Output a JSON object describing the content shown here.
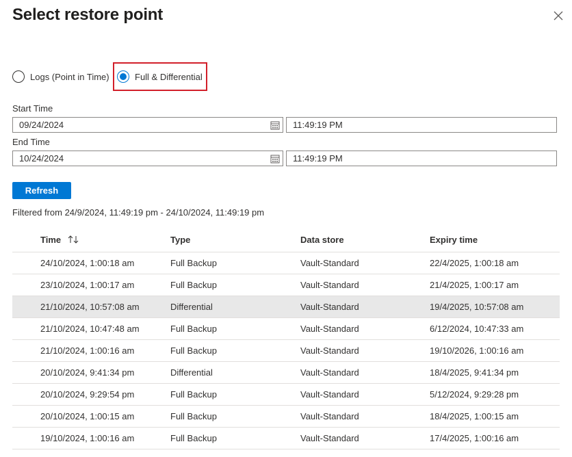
{
  "dialog": {
    "title": "Select restore point"
  },
  "restore_type": {
    "options": [
      {
        "label": "Logs (Point in Time)",
        "selected": false
      },
      {
        "label": "Full & Differential",
        "selected": true
      }
    ]
  },
  "filters": {
    "start_label": "Start Time",
    "start_date": "09/24/2024",
    "start_time": "11:49:19 PM",
    "end_label": "End Time",
    "end_date": "10/24/2024",
    "end_time": "11:49:19 PM"
  },
  "refresh_label": "Refresh",
  "filtered_text": "Filtered from 24/9/2024, 11:49:19 pm - 24/10/2024, 11:49:19 pm",
  "table": {
    "headers": [
      "Time",
      "Type",
      "Data store",
      "Expiry time"
    ],
    "sort_icon": "sort-icon",
    "rows": [
      [
        "24/10/2024, 1:00:18 am",
        "Full Backup",
        "Vault-Standard",
        "22/4/2025, 1:00:18 am"
      ],
      [
        "23/10/2024, 1:00:17 am",
        "Full Backup",
        "Vault-Standard",
        "21/4/2025, 1:00:17 am"
      ],
      [
        "21/10/2024, 10:57:08 am",
        "Differential",
        "Vault-Standard",
        "19/4/2025, 10:57:08 am"
      ],
      [
        "21/10/2024, 10:47:48 am",
        "Full Backup",
        "Vault-Standard",
        "6/12/2024, 10:47:33 am"
      ],
      [
        "21/10/2024, 1:00:16 am",
        "Full Backup",
        "Vault-Standard",
        "19/10/2026, 1:00:16 am"
      ],
      [
        "20/10/2024, 9:41:34 pm",
        "Differential",
        "Vault-Standard",
        "18/4/2025, 9:41:34 pm"
      ],
      [
        "20/10/2024, 9:29:54 pm",
        "Full Backup",
        "Vault-Standard",
        "5/12/2024, 9:29:28 pm"
      ],
      [
        "20/10/2024, 1:00:15 am",
        "Full Backup",
        "Vault-Standard",
        "18/4/2025, 1:00:15 am"
      ],
      [
        "19/10/2024, 1:00:16 am",
        "Full Backup",
        "Vault-Standard",
        "17/4/2025, 1:00:16 am"
      ]
    ],
    "highlighted_row": 2
  },
  "colors": {
    "accent": "#0078d4",
    "highlight_border": "#d21f2a",
    "row_highlight": "#e8e8e8"
  }
}
